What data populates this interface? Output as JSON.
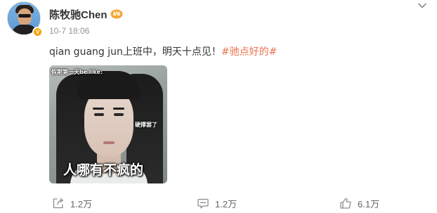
{
  "post": {
    "username": "陈牧驰Chen",
    "timestamp": "10-7 18:06",
    "text_plain": "qian guang jun上班中，明天十点见！",
    "hashtag": "#驰点好的#",
    "verified_badge": "V",
    "image": {
      "caption_top": "假期第一天be like:",
      "caption_middle": "硬撑罢了",
      "caption_bottom": "人哪有不疯的"
    }
  },
  "actions": {
    "share_count": "1.2万",
    "comment_count": "1.2万",
    "like_count": "6.1万"
  },
  "colors": {
    "hashtag": "#eb7350",
    "badge": "#f7a400",
    "crown": "#f3a73b"
  },
  "icons": {
    "crown": "crown-icon",
    "more": "chevron-down-icon",
    "share": "share-icon",
    "comment": "comment-icon",
    "like": "thumbs-up-icon"
  }
}
